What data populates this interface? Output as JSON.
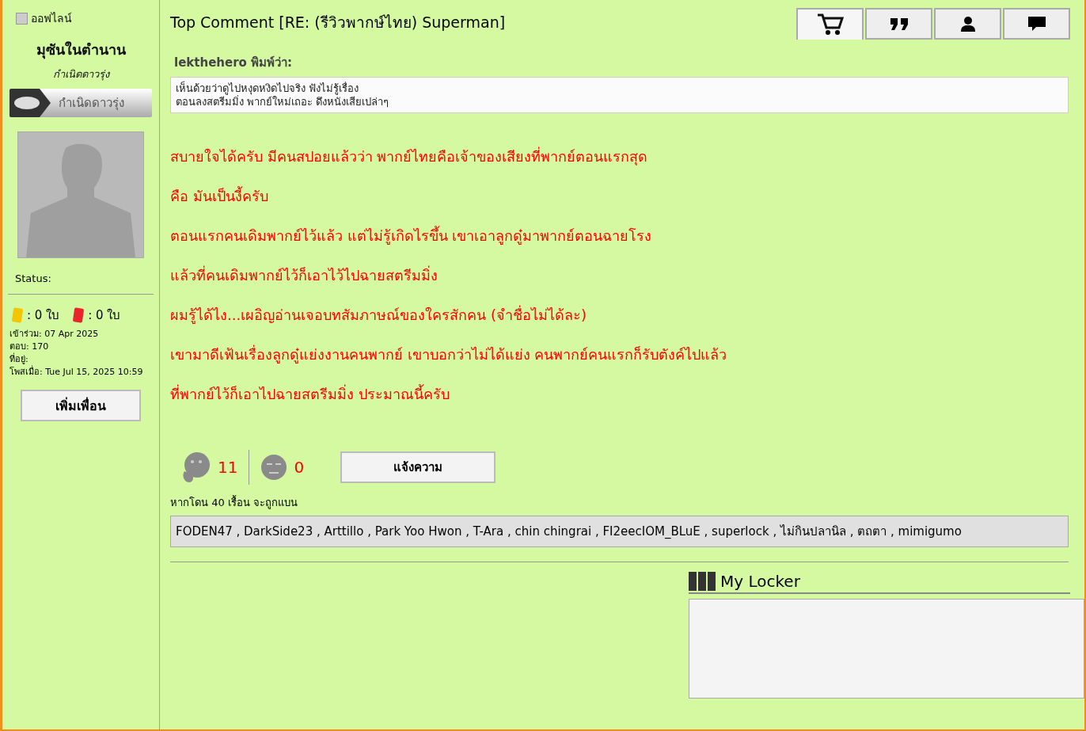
{
  "profile": {
    "online": false,
    "status_label": "ออฟไลน์",
    "username": "มุซันในตำนาน",
    "rank": "กำเนิดดาวรุ่ง",
    "rank_badge": "กำเนิดดาวรุ่ง",
    "status": "Status:",
    "cards": [
      {
        "kind": "yellow",
        "count": ": 0 ใบ"
      },
      {
        "kind": "red",
        "count": ": 0 ใบ"
      }
    ],
    "details": [
      "เข้าร่วม: 07 Apr 2025",
      "ตอบ: 170",
      "ที่อยู่:",
      "โพสเมื่อ: Tue Jul 15, 2025 10:59"
    ],
    "add_friend": "เพิ่มเพื่อน"
  },
  "post": {
    "title": "Top Comment [RE: (รีวิวพากษ์ไทย) Superman]",
    "tabs": [
      {
        "kind": "cart",
        "selected": true
      },
      {
        "kind": "quote",
        "selected": false
      },
      {
        "kind": "user",
        "selected": false
      },
      {
        "kind": "chat",
        "selected": false
      }
    ],
    "quote": {
      "author": "lekthehero พิมพ์ว่า:",
      "lines": [
        "เห็นด้วยว่าดูไปหงุดหงิดไปจริง ฟังไม่รู้เรื่อง",
        "ตอนลงสตรีมมิ่ง พากย์ใหม่เถอะ ดึงหนังเสียเปล่าๆ"
      ]
    },
    "body": [
      "สบายใจได้ครับ มีคนสปอยแล้วว่า พากย์ไทยคือเจ้าของเสียงที่พากย์ตอนแรกสุด",
      "คือ มันเป็นงี้ครับ",
      "ตอนแรกคนเดิมพากย์ไว้แล้ว แต่ไม่รู้เกิดไรขึ้น เขาเอาลูกดู๋มาพากย์ตอนฉายโรง",
      "แล้วที่คนเดิมพากย์ไว้ก็เอาไว้ไปฉายสตรีมมิ่ง",
      "ผมรู้ได้ไง...เผอิญอ่านเจอบทสัมภาษณ์ของใครสักคน (จำชื่อไม่ได้ละ)",
      "เขามาดีเฟ้นเรื่องลูกดู๋แย่งงานคนพากย์ เขาบอกว่าไม่ได้แย่ง คนพากย์คนแรกก็รับตังค์ไปแล้ว",
      "ที่พากย์ไว้ก็เอาไปฉายสตรีมมิ่ง ประมาณนี้ครับ"
    ],
    "likes": "11",
    "dislikes": "0",
    "report": "แจ้งความ",
    "ban_note": "หากโดน 40 เรื้อน จะถูกแบน",
    "voters": "FODEN47 , DarkSide23 , Arttillo , Park Yoo Hwon , T-Ara , chin chingrai , FI2eecIOM_BLuE , superlock , ไม่กินปลานิล , ตถตา , mimigumo",
    "locker_title": "My Locker"
  }
}
